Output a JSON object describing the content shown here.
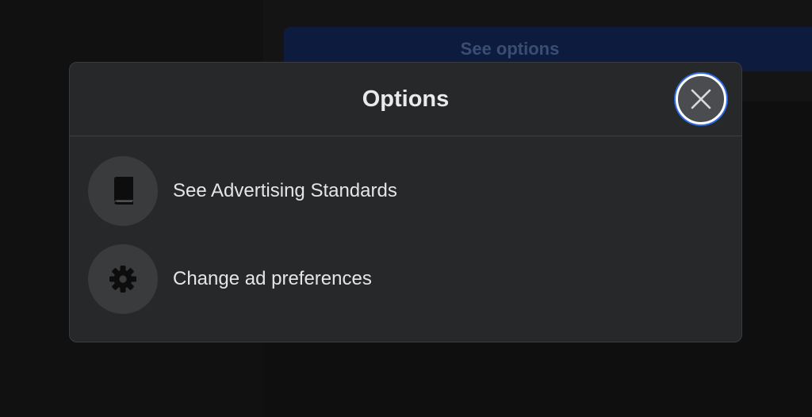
{
  "background": {
    "see_options_label": "See options"
  },
  "modal": {
    "title": "Options",
    "close_icon": "close-icon",
    "options": [
      {
        "label": "See Advertising Standards",
        "icon": "book-icon"
      },
      {
        "label": "Change ad preferences",
        "icon": "gear-icon"
      }
    ]
  },
  "colors": {
    "accent": "#2d6be6",
    "modal_bg": "#27282a",
    "icon_circle": "#3a3b3d"
  }
}
